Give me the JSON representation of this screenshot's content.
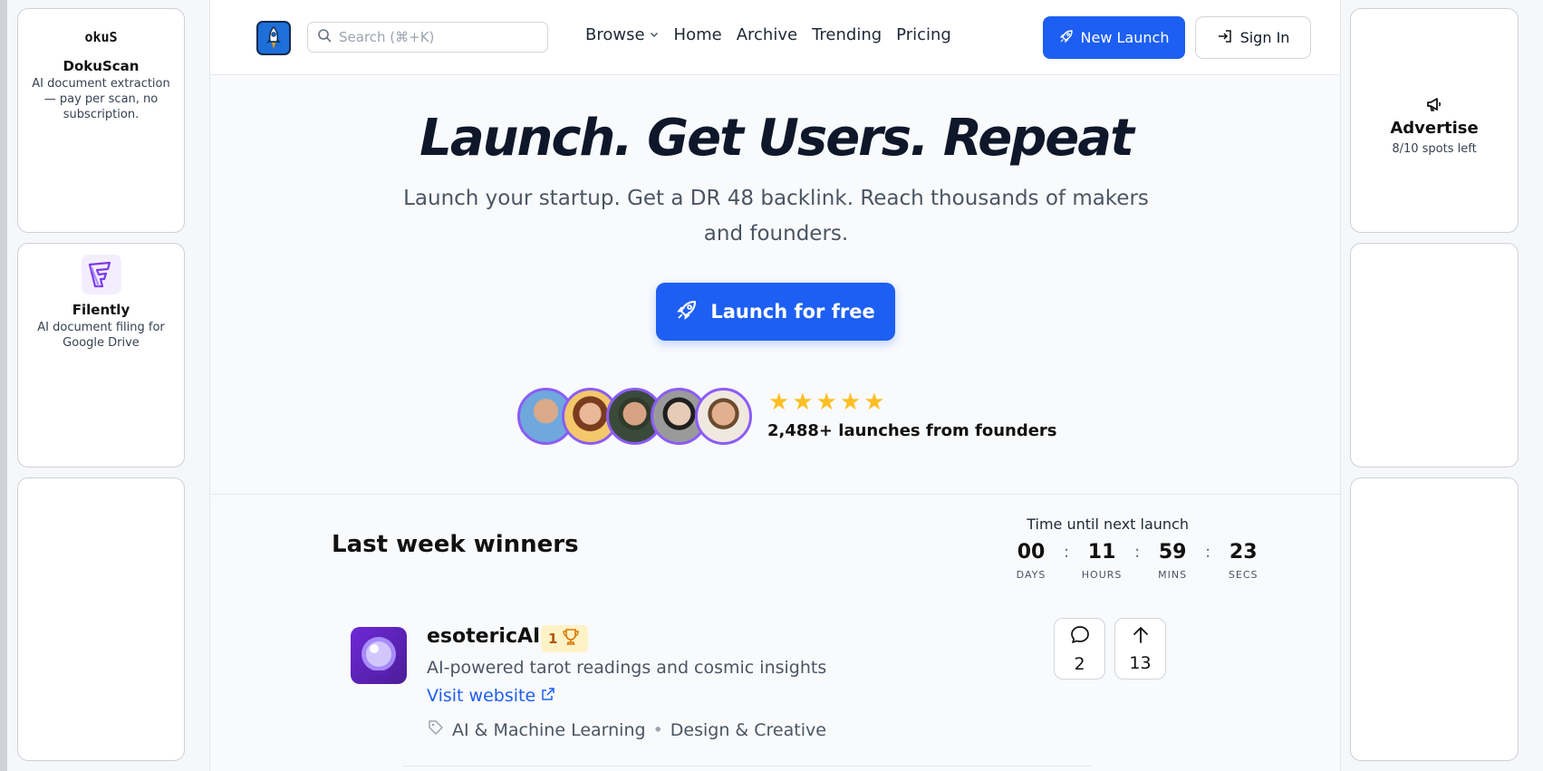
{
  "left_ads": [
    {
      "logo_text": "okuS",
      "name": "DokuScan",
      "desc": "AI document extraction — pay per scan, no subscription."
    },
    {
      "name": "Filently",
      "desc": "AI document filing for Google Drive"
    },
    {}
  ],
  "right_ads": [
    {
      "name": "Advertise",
      "desc": "8/10 spots left"
    },
    {},
    {}
  ],
  "header": {
    "search_placeholder": "Search (⌘+K)",
    "nav": {
      "browse": "Browse",
      "home": "Home",
      "archive": "Archive",
      "trending": "Trending",
      "pricing": "Pricing"
    },
    "new_launch": "New Launch",
    "sign_in": "Sign In"
  },
  "hero": {
    "title": "Launch. Get Users. Repeat",
    "subtitle": "Launch your startup. Get a DR 48 backlink. Reach thousands of makers and founders.",
    "cta": "Launch for free",
    "stars": "★★★★★",
    "rating": 5,
    "launch_count": "2,488+ launches from founders"
  },
  "winners": {
    "title": "Last week winners",
    "countdown_label": "Time until next launch",
    "countdown": [
      {
        "value": "00",
        "label": "DAYS"
      },
      {
        "value": "11",
        "label": "HOURS"
      },
      {
        "value": "59",
        "label": "MINS"
      },
      {
        "value": "23",
        "label": "SECS"
      }
    ],
    "product": {
      "name": "esotericAI",
      "rank": "1",
      "desc": "AI-powered tarot readings and cosmic insights",
      "link": "Visit website",
      "tags": [
        "AI & Machine Learning",
        "Design & Creative"
      ],
      "comments": "2",
      "upvotes": "13"
    }
  },
  "colors": {
    "accent": "#1d5ff2",
    "avatar_ring": "#8b5cf6",
    "star": "#fbbf24",
    "badge_bg": "#fef3c7"
  }
}
